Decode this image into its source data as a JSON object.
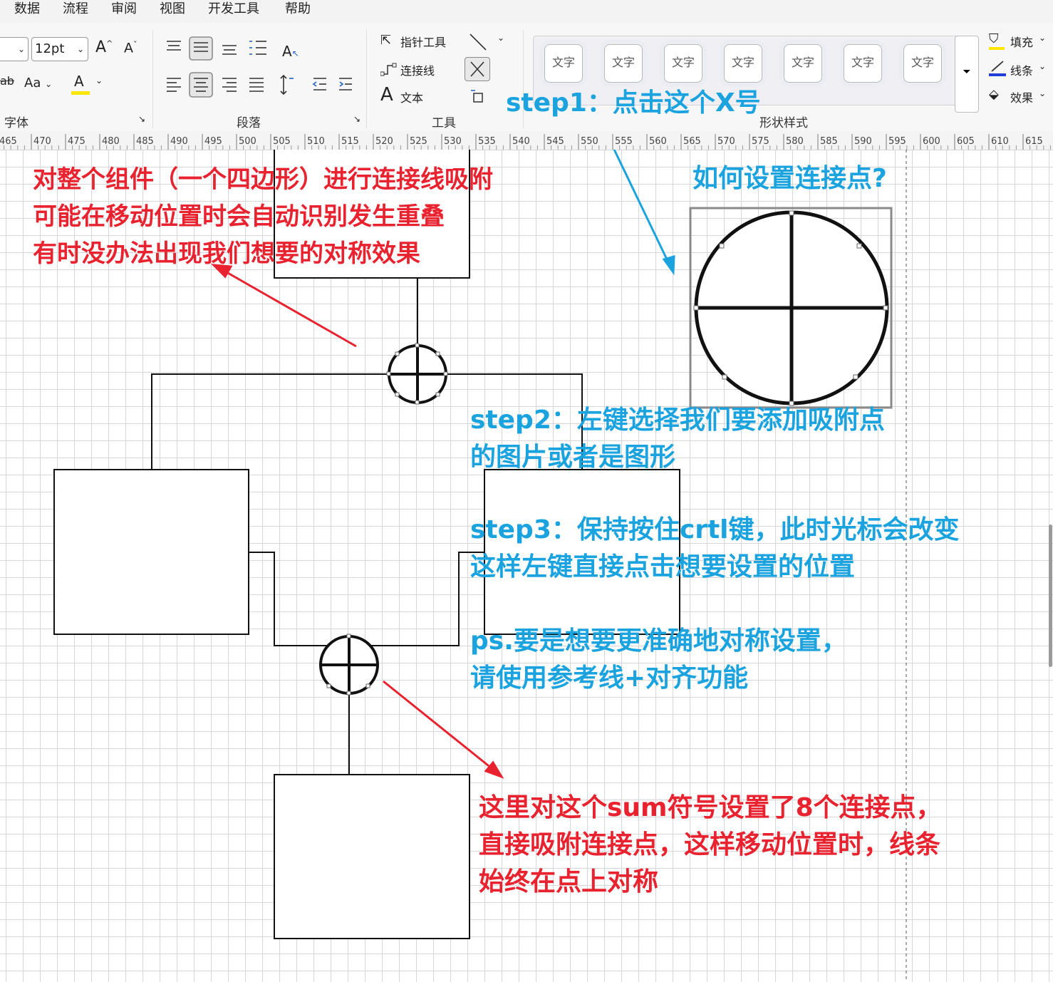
{
  "menu": [
    "数据",
    "流程",
    "审阅",
    "视图",
    "开发工具",
    "帮助"
  ],
  "ribbon": {
    "font_group": {
      "font_size": "12pt",
      "grow_font": "A",
      "shrink_font": "A",
      "case_button": "Aa",
      "font_color_button": "A",
      "label": "字体",
      "font_color": "#ffe600"
    },
    "paragraph_group": {
      "label": "段落"
    },
    "tools_group": {
      "pointer_tool": "指针工具",
      "connector": "连接线",
      "text_glyph": "A",
      "text_tool": "文本",
      "label": "工具"
    },
    "shape_styles": {
      "items": [
        "文字",
        "文字",
        "文字",
        "文字",
        "文字",
        "文字",
        "文字"
      ],
      "label": "形状样式"
    },
    "format_group": {
      "fill": "填充",
      "line": "线条",
      "effect": "效果"
    }
  },
  "ruler": {
    "ticks": [
      "465",
      "470",
      "475",
      "480",
      "485",
      "490",
      "495",
      "500",
      "505",
      "510",
      "515",
      "520",
      "525",
      "530",
      "535",
      "540",
      "545",
      "550",
      "555",
      "560",
      "565",
      "570",
      "575",
      "580",
      "585",
      "590",
      "595",
      "600",
      "605",
      "610",
      "615"
    ]
  },
  "annotations": {
    "red_top": [
      "对整个组件（一个四边形）进行连接线吸附",
      "可能在移动位置时会自动识别发生重叠",
      "有时没办法出现我们想要的对称效果"
    ],
    "step1": "step1：点击这个X号",
    "how_title": "如何设置连接点?",
    "step2": [
      "step2：左键选择我们要添加吸附点",
      "的图片或者是图形"
    ],
    "step3": [
      "step3：保持按住crtl键，此时光标会改变",
      "这样左键直接点击想要设置的位置"
    ],
    "ps": [
      "ps.要是想要更准确地对称设置，",
      "请使用参考线+对齐功能"
    ],
    "red_bottom": [
      "这里对这个sum符号设置了8个连接点，",
      "直接吸附连接点，这样移动位置时，线条",
      "始终在点上对称"
    ]
  },
  "colors": {
    "annotation_red": "#e8232f",
    "annotation_blue": "#1aa3df",
    "line_color_swatch": "#1f3fd6",
    "fill_swatch": "#ffe600"
  },
  "icons": [
    "strikethrough-icon",
    "align-top-icon",
    "align-middle-icon",
    "align-bottom-icon",
    "bullet-list-icon",
    "text-direction-icon",
    "align-left-icon",
    "align-center-icon",
    "align-right-icon",
    "justify-icon",
    "line-spacing-icon",
    "decrease-indent-icon",
    "increase-indent-icon",
    "pointer-icon",
    "connector-icon",
    "line-tool-icon",
    "connection-point-x-icon",
    "crop-icon",
    "more-styles-icon",
    "fill-icon",
    "line-color-icon",
    "effect-icon",
    "dialog-launcher-icon"
  ]
}
